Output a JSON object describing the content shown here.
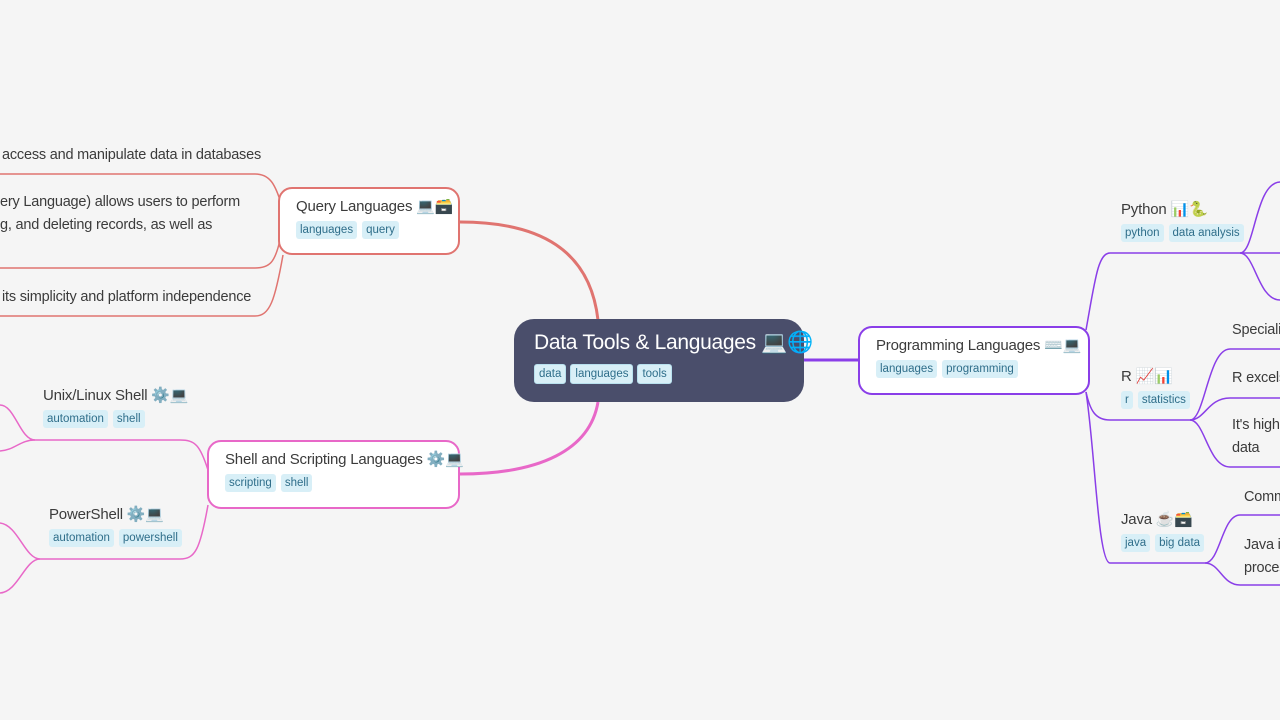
{
  "colors": {
    "background": "#f5f5f5",
    "root": "#4a4e6b",
    "query": "#e07470",
    "shell": "#e868c8",
    "programming": "#8a3ee8",
    "tag_bg": "#d8eff7",
    "tag_text": "#2f6e8a"
  },
  "root": {
    "title": "Data Tools & Languages 💻🌐",
    "tags": [
      "data",
      "languages",
      "tools"
    ]
  },
  "branches": {
    "query": {
      "title": "Query Languages 💻🗃️",
      "tags": [
        "languages",
        "query"
      ],
      "children": [
        {
          "lines": [
            "access and manipulate data in databases"
          ]
        },
        {
          "lines": [
            "ery Language) allows users to perform",
            "g, and deleting records, as well as"
          ]
        },
        {
          "lines": [
            "its simplicity and platform independence"
          ]
        }
      ]
    },
    "shell": {
      "title": "Shell and Scripting Languages ⚙️💻",
      "tags": [
        "scripting",
        "shell"
      ],
      "children": [
        {
          "title": "Unix/Linux Shell ⚙️💻",
          "tags": [
            "automation",
            "shell"
          ]
        },
        {
          "title": "PowerShell ⚙️💻",
          "tags": [
            "automation",
            "powershell"
          ]
        }
      ]
    },
    "programming": {
      "title": "Programming Languages ⌨️💻",
      "tags": [
        "languages",
        "programming"
      ],
      "children": [
        {
          "title": "Python 📊🐍",
          "tags": [
            "python",
            "data analysis"
          ],
          "details": []
        },
        {
          "title": "R 📈📊",
          "tags": [
            "r",
            "statistics"
          ],
          "details": [
            "Speciali",
            "R excels",
            "It's high",
            "data"
          ]
        },
        {
          "title": "Java ☕🗃️",
          "tags": [
            "java",
            "big data"
          ],
          "details": [
            "Comm",
            "Java is",
            "proces"
          ]
        }
      ]
    }
  }
}
